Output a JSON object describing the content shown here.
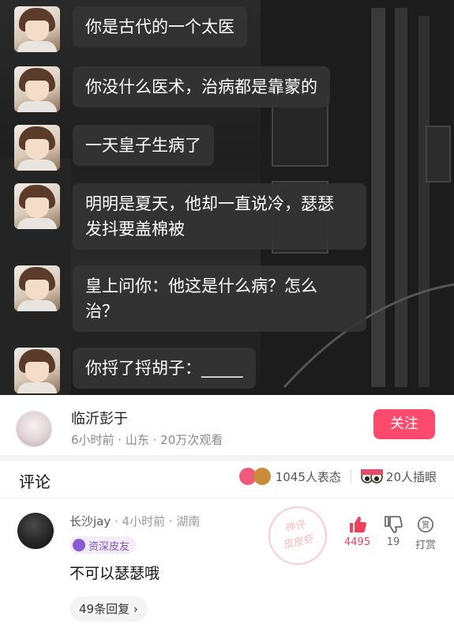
{
  "chat": {
    "back_icon": "chevron-left-icon",
    "messages": [
      "你是古代的一个太医",
      "你没什么医术，治病都是靠蒙的",
      "一天皇子生病了",
      "明明是夏天，他却一直说冷，瑟瑟\n发抖要盖棉被",
      "皇上问你：他这是什么病？怎么\n治？",
      "你捋了捋胡子：_____"
    ]
  },
  "author": {
    "name": "临沂彭于",
    "meta": "6小时前 · 山东 · 20万次观看",
    "follow_label": "关注"
  },
  "comments_header": {
    "title": "评论",
    "reactions_text": "1045人表态",
    "eye_text": "20人插眼"
  },
  "comment": {
    "user": "长沙jay",
    "meta": " · 4小时前 · 湖南",
    "badge": "资深皮友",
    "text": "不可以瑟瑟哦",
    "replies": "49条回复 ›",
    "stamp_line1": "神评",
    "stamp_line2": "皮皮虾",
    "likes": "4495",
    "dislikes": "19",
    "reward": "打赏",
    "reward_icon_text": "赏"
  },
  "colors": {
    "accent": "#fe4a6c",
    "like": "#f0415c",
    "badge": "#7a55b8"
  }
}
